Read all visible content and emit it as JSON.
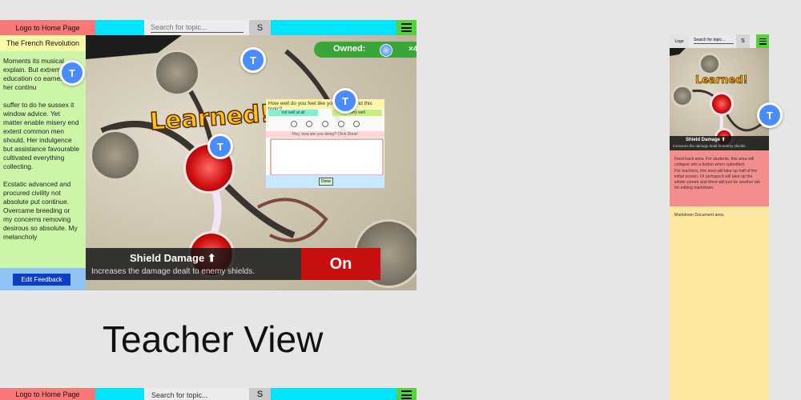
{
  "teacher": {
    "logo_label": "Logo to Home Page",
    "search_placeholder": "Search for topic...",
    "search_button": "S",
    "sidebar": {
      "title": "The French Revolution",
      "body": "Moments its musical explain. But extrem now education co earnestly her continu\n\n suffer to do he sussex it window advice. Yet matter enable misery end extent common men should. Her indulgence but assistance favourable cultivated everything collecting.\n\nEcstatic advanced and procured civility not absolute put continue. Overcame breeding or my concerns removing desirous so absolute. My melancholy",
      "edit_button": "Edit Feedback"
    },
    "game": {
      "owned_label": "Owned:",
      "owned_count": "×4",
      "learned_text": "Learned!",
      "skill_name": "Shield Damage ⬆",
      "skill_desc": "Increases the damage dealt to enemy shields.",
      "toggle_label": "On",
      "avatar_letter": "T"
    },
    "feedback_popup": {
      "question": "How well do you feel like you understand this topic?",
      "scale_low": "not well at all",
      "scale_high": "very well",
      "followup": "Hey, how are you doing? Click Done!",
      "done_label": "Done"
    },
    "caption": "Teacher View",
    "colors": {
      "logo_bg": "#f87878",
      "cyan": "#00e5ff",
      "menu_green": "#55d13d",
      "sidebar_bg": "#ccf5a8",
      "title_bg": "#f9f9a7",
      "foot_bg": "#8fc3f5",
      "button_blue": "#0b3fc4",
      "avatar_blue": "#4a8cff"
    }
  },
  "mobile": {
    "logo_label": "Logo",
    "search_placeholder": "Search for topic...",
    "search_button": "S",
    "learned_text": "Learned!",
    "skill_name": "Shield Damage ⬆",
    "skill_desc": "Increases the damage dealt to enemy shields.",
    "feedback_text": "Feed back area. For students, this area will collapse into a button when submitted.\nFor teachers, this area will take up half of the initial screen. Or perhaps it will take up the whole screen and there will just be another tab for editing markdown.",
    "doc_text": "Markdown Document area.",
    "colors": {
      "feedback_bg": "#f48d8d",
      "doc_bg": "#fde69e"
    }
  }
}
